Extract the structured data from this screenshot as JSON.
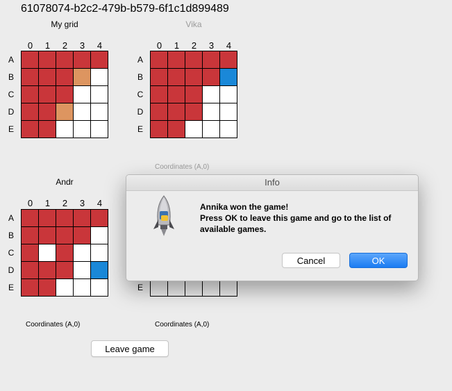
{
  "window": {
    "game_id": "61078074-b2c2-479b-b579-6f1c1d899489"
  },
  "columns": [
    "0",
    "1",
    "2",
    "3",
    "4"
  ],
  "rows": [
    "A",
    "B",
    "C",
    "D",
    "E"
  ],
  "grids": [
    {
      "title": "My grid",
      "cells": [
        [
          "R",
          "R",
          "R",
          "R",
          "R"
        ],
        [
          "R",
          "R",
          "R",
          "O",
          "W"
        ],
        [
          "R",
          "R",
          "R",
          "W",
          "W"
        ],
        [
          "R",
          "R",
          "O",
          "W",
          "W"
        ],
        [
          "R",
          "R",
          "W",
          "W",
          "W"
        ]
      ]
    },
    {
      "title": "Vika",
      "coordinates": "Coordinates (A,0)",
      "cells": [
        [
          "R",
          "R",
          "R",
          "R",
          "R"
        ],
        [
          "R",
          "R",
          "R",
          "R",
          "B"
        ],
        [
          "R",
          "R",
          "R",
          "W",
          "W"
        ],
        [
          "R",
          "R",
          "R",
          "W",
          "W"
        ],
        [
          "R",
          "R",
          "W",
          "W",
          "W"
        ]
      ]
    },
    {
      "title": "Andr",
      "coordinates": "Coordinates (A,0)",
      "cells": [
        [
          "R",
          "R",
          "R",
          "R",
          "R"
        ],
        [
          "R",
          "R",
          "R",
          "R",
          "W"
        ],
        [
          "R",
          "W",
          "R",
          "W",
          "W"
        ],
        [
          "R",
          "R",
          "R",
          "W",
          "B"
        ],
        [
          "R",
          "R",
          "W",
          "W",
          "W"
        ]
      ]
    },
    {
      "title": "",
      "coordinates": "Coordinates (A,0)",
      "cells": [
        [
          "G",
          "G",
          "G",
          "G",
          "G"
        ],
        [
          "G",
          "G",
          "G",
          "G",
          "G"
        ],
        [
          "G",
          "G",
          "G",
          "G",
          "G"
        ],
        [
          "G",
          "G",
          "G",
          "G",
          "G"
        ],
        [
          "G",
          "G",
          "G",
          "G",
          "G"
        ]
      ]
    }
  ],
  "leave_button": "Leave game",
  "dialog": {
    "title": "Info",
    "message": "Annika won the game!\n Press OK to leave this game and go to the list of available games.",
    "cancel": "Cancel",
    "ok": "OK",
    "icon": "python-rocket-icon"
  },
  "colors": {
    "hit": "#c9363a",
    "empty": "#ffffff",
    "ship": "#dd9560",
    "miss": "#1a88d8",
    "accent": "#1b7cf2"
  }
}
